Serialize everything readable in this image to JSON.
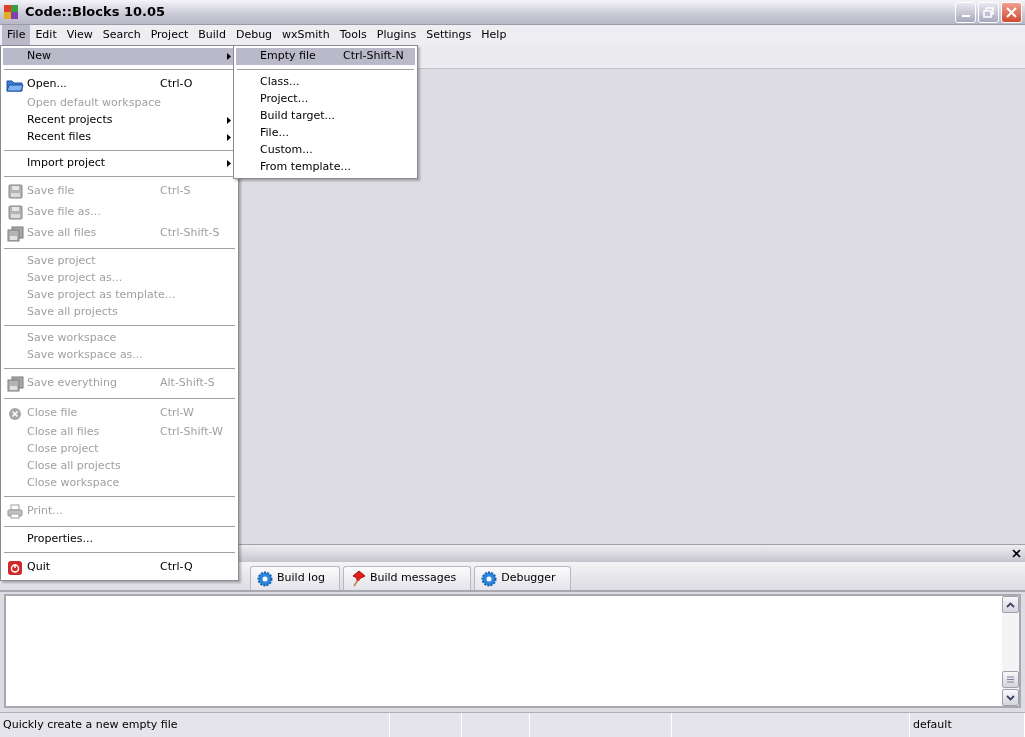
{
  "window": {
    "title": "Code::Blocks 10.05"
  },
  "menubar": [
    {
      "label": "File",
      "selected": true
    },
    {
      "label": "Edit",
      "selected": false
    },
    {
      "label": "View",
      "selected": false
    },
    {
      "label": "Search",
      "selected": false
    },
    {
      "label": "Project",
      "selected": false
    },
    {
      "label": "Build",
      "selected": false
    },
    {
      "label": "Debug",
      "selected": false
    },
    {
      "label": "wxSmith",
      "selected": false
    },
    {
      "label": "Tools",
      "selected": false
    },
    {
      "label": "Plugins",
      "selected": false
    },
    {
      "label": "Settings",
      "selected": false
    },
    {
      "label": "Help",
      "selected": false
    }
  ],
  "file_menu": {
    "items": [
      {
        "kind": "item",
        "label": "New",
        "disabled": false,
        "selected": true,
        "has_submenu": true
      },
      {
        "kind": "separator"
      },
      {
        "kind": "item",
        "label": "Open...",
        "shortcut": "Ctrl-O",
        "disabled": false,
        "selected": false,
        "has_submenu": false
      },
      {
        "kind": "item",
        "label": "Open default workspace",
        "disabled": true,
        "selected": false,
        "has_submenu": false
      },
      {
        "kind": "item",
        "label": "Recent projects",
        "disabled": false,
        "selected": false,
        "has_submenu": true
      },
      {
        "kind": "item",
        "label": "Recent files",
        "disabled": false,
        "selected": false,
        "has_submenu": true
      },
      {
        "kind": "separator"
      },
      {
        "kind": "item",
        "label": "Import project",
        "disabled": false,
        "selected": false,
        "has_submenu": true
      },
      {
        "kind": "separator"
      },
      {
        "kind": "item",
        "label": "Save file",
        "shortcut": "Ctrl-S",
        "disabled": true,
        "selected": false,
        "has_submenu": false
      },
      {
        "kind": "item",
        "label": "Save file as...",
        "disabled": true,
        "selected": false,
        "has_submenu": false
      },
      {
        "kind": "item",
        "label": "Save all files",
        "shortcut": "Ctrl-Shift-S",
        "disabled": true,
        "selected": false,
        "has_submenu": false
      },
      {
        "kind": "separator"
      },
      {
        "kind": "item",
        "label": "Save project",
        "disabled": true,
        "selected": false,
        "has_submenu": false
      },
      {
        "kind": "item",
        "label": "Save project as...",
        "disabled": true,
        "selected": false,
        "has_submenu": false
      },
      {
        "kind": "item",
        "label": "Save project as template...",
        "disabled": true,
        "selected": false,
        "has_submenu": false
      },
      {
        "kind": "item",
        "label": "Save all projects",
        "disabled": true,
        "selected": false,
        "has_submenu": false
      },
      {
        "kind": "separator"
      },
      {
        "kind": "item",
        "label": "Save workspace",
        "disabled": true,
        "selected": false,
        "has_submenu": false
      },
      {
        "kind": "item",
        "label": "Save workspace as...",
        "disabled": true,
        "selected": false,
        "has_submenu": false
      },
      {
        "kind": "separator"
      },
      {
        "kind": "item",
        "label": "Save everything",
        "shortcut": "Alt-Shift-S",
        "disabled": true,
        "selected": false,
        "has_submenu": false
      },
      {
        "kind": "separator"
      },
      {
        "kind": "item",
        "label": "Close file",
        "shortcut": "Ctrl-W",
        "disabled": true,
        "selected": false,
        "has_submenu": false
      },
      {
        "kind": "item",
        "label": "Close all files",
        "shortcut": "Ctrl-Shift-W",
        "disabled": true,
        "selected": false,
        "has_submenu": false
      },
      {
        "kind": "item",
        "label": "Close project",
        "disabled": true,
        "selected": false,
        "has_submenu": false
      },
      {
        "kind": "item",
        "label": "Close all projects",
        "disabled": true,
        "selected": false,
        "has_submenu": false
      },
      {
        "kind": "item",
        "label": "Close workspace",
        "disabled": true,
        "selected": false,
        "has_submenu": false
      },
      {
        "kind": "separator"
      },
      {
        "kind": "item",
        "label": "Print...",
        "disabled": true,
        "selected": false,
        "has_submenu": false
      },
      {
        "kind": "separator"
      },
      {
        "kind": "item",
        "label": "Properties...",
        "disabled": false,
        "selected": false,
        "has_submenu": false
      },
      {
        "kind": "separator"
      },
      {
        "kind": "item",
        "label": "Quit",
        "shortcut": "Ctrl-Q",
        "disabled": false,
        "selected": false,
        "has_submenu": false
      }
    ]
  },
  "new_submenu": {
    "items": [
      {
        "kind": "item",
        "label": "Empty file",
        "shortcut": "Ctrl-Shift-N",
        "disabled": false,
        "selected": true
      },
      {
        "kind": "separator"
      },
      {
        "kind": "item",
        "label": "Class...",
        "disabled": false,
        "selected": false
      },
      {
        "kind": "item",
        "label": "Project...",
        "disabled": false,
        "selected": false
      },
      {
        "kind": "item",
        "label": "Build target...",
        "disabled": false,
        "selected": false
      },
      {
        "kind": "item",
        "label": "File...",
        "disabled": false,
        "selected": false
      },
      {
        "kind": "item",
        "label": "Custom...",
        "disabled": false,
        "selected": false
      },
      {
        "kind": "item",
        "label": "From template...",
        "disabled": false,
        "selected": false
      }
    ]
  },
  "log_panel": {
    "tabs": [
      {
        "label": "Build log",
        "selected": false
      },
      {
        "label": "Build messages",
        "selected": false
      },
      {
        "label": "Debugger",
        "selected": false
      }
    ]
  },
  "status_bar": {
    "message": "Quickly create a new empty file",
    "profile": "default"
  }
}
